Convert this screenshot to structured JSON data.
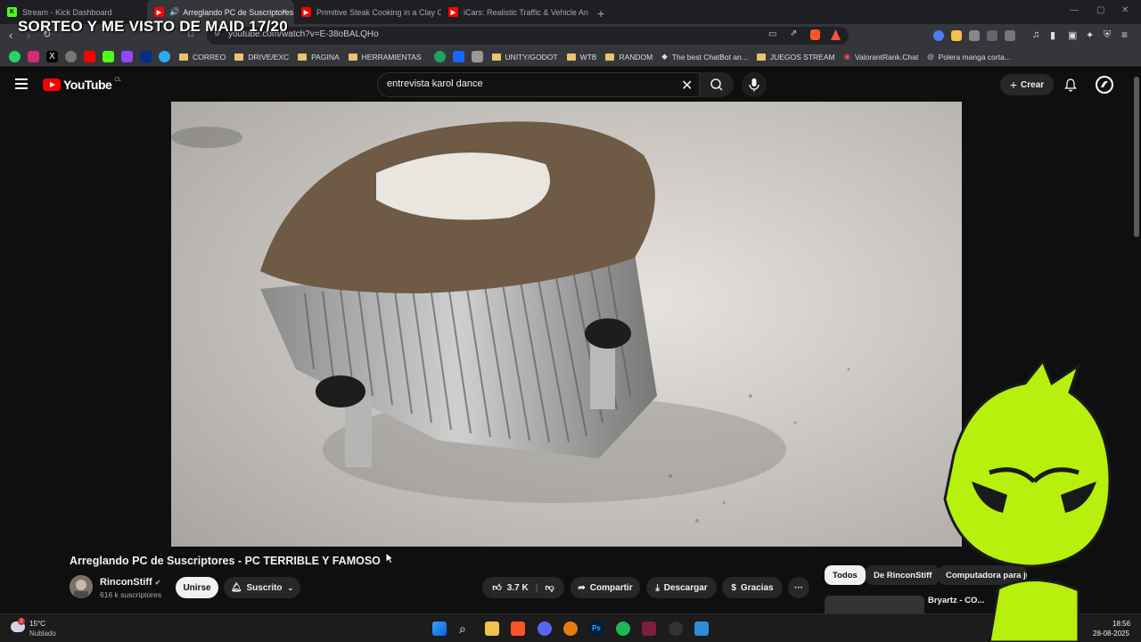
{
  "browser": {
    "tabs": [
      {
        "label": "Stream - Kick Dashboard",
        "icon": "kick-icon",
        "color": "#53fc18"
      },
      {
        "label": "Arreglando PC de Suscriptores",
        "icon": "youtube-icon",
        "color": "#ff0000",
        "active": true
      },
      {
        "label": "Primitive Steak Cooking in a Clay Ov...",
        "icon": "youtube-icon",
        "color": "#ff0000"
      },
      {
        "label": "iCars: Realistic Traffic & Vehicle Anim...",
        "icon": "youtube-icon",
        "color": "#ff0000"
      }
    ],
    "tab_close": "×",
    "new_tab": "+",
    "url": "youtube.com/watch?v=E-38oBALQHo",
    "stream_overlay": "SORTEO Y ME VISTO DE MAID 17/20",
    "bookmarks": [
      {
        "label": "CORREO"
      },
      {
        "label": "DRIVE/EXC"
      },
      {
        "label": "PAGINA"
      },
      {
        "label": "HERRAMIENTAS"
      },
      {
        "label": "UNITY/GODOT"
      },
      {
        "label": "WTB"
      },
      {
        "label": "RANDOM"
      },
      {
        "label": "The best ChatBot an..."
      },
      {
        "label": "JUEGOS STREAM"
      },
      {
        "label": "ValorantRank.Chat"
      },
      {
        "label": "Polera manga corta..."
      }
    ]
  },
  "youtube": {
    "logo": "YouTube",
    "country": "CL",
    "search_value": "entrevista karol dance",
    "create_label": "Crear",
    "video_title": "Arreglando PC de Suscriptores - PC TERRIBLE Y FAMOSO",
    "channel_name": "RinconStiff",
    "subscribers": "616 k suscriptores",
    "join_label": "Unirse",
    "subscribed_label": "Suscrito",
    "likes": "3.7 K",
    "share_label": "Compartir",
    "download_label": "Descargar",
    "thanks_label": "Gracias",
    "more_label": "···",
    "chips": [
      "Todos",
      "De RinconStiff",
      "Computadora para ju..."
    ],
    "rec_channel": "Bryartz - CO..."
  },
  "taskbar": {
    "temp": "15°C",
    "weather": "Nublado",
    "time": "18:56",
    "date": "28-08-2025"
  }
}
